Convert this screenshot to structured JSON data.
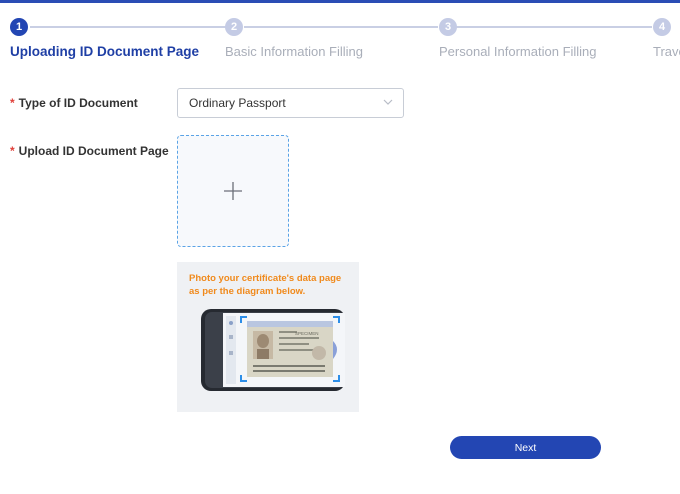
{
  "steps": [
    {
      "number": "1",
      "label": "Uploading ID Document Page"
    },
    {
      "number": "2",
      "label": "Basic Information Filling"
    },
    {
      "number": "3",
      "label": "Personal Information Filling"
    },
    {
      "number": "4",
      "label": "Trave"
    }
  ],
  "form": {
    "required_mark": "*",
    "id_type_label": "Type of ID Document",
    "id_type_value": "Ordinary Passport",
    "upload_label": "Upload ID Document Page"
  },
  "guide": {
    "text": "Photo your certificate's data page as per the diagram below.",
    "specimen_text": "SPECIMEN"
  },
  "actions": {
    "next_label": "Next"
  },
  "colors": {
    "primary": "#2346b3",
    "step_inactive": "#c4cbe5",
    "required": "#e0403a",
    "guide_text": "#f08a1c",
    "upload_border": "#5aa3e6"
  },
  "icons": {
    "select_arrow": "chevron-down-icon",
    "upload": "plus-icon"
  }
}
